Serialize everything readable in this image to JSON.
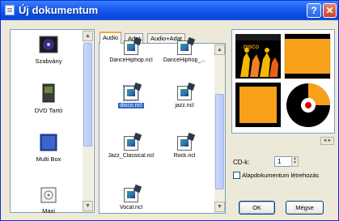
{
  "window": {
    "title": "Új dokumentum"
  },
  "titlebar": {
    "help": "?",
    "close": "✕"
  },
  "templates": [
    {
      "label": "Szabvány",
      "icon": "cd-disc-icon"
    },
    {
      "label": "DVD Tartó",
      "icon": "dvd-case-icon"
    },
    {
      "label": "Multi Box",
      "icon": "multi-box-icon"
    },
    {
      "label": "Maxi",
      "icon": "maxi-case-icon"
    }
  ],
  "tabs": [
    "Audio",
    "Adat",
    "Audio+Adat"
  ],
  "files": [
    {
      "label": "DanceHiphop.ncl"
    },
    {
      "label": "DanceHiphop_..."
    },
    {
      "label": "disco.ncl",
      "selected": true
    },
    {
      "label": "jazz.ncl"
    },
    {
      "label": "Jazz_Classical.ncl"
    },
    {
      "label": "Rock.ncl"
    },
    {
      "label": "Vocal.ncl"
    }
  ],
  "preview": {
    "disc_text": "DISCO",
    "colors": {
      "orange": "#f8a01a",
      "black": "#000000"
    }
  },
  "options": {
    "cd_label": "CD-k:",
    "cd_count": "1",
    "base_doc_label": "Alapdokumentum létrehozás"
  },
  "buttons": {
    "ok": "OK",
    "cancel": "Mégse"
  }
}
